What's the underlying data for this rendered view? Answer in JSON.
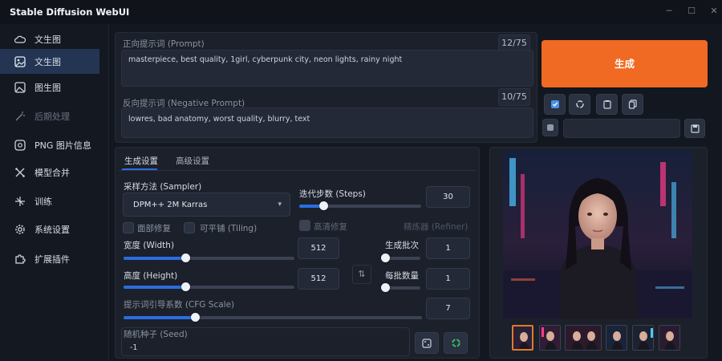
{
  "app": {
    "title": "Stable Diffusion WebUI"
  },
  "window": {
    "minimize_icon": "minimize-icon",
    "maximize_icon": "maximize-icon",
    "close_icon": "close-icon"
  },
  "sidebar": {
    "items": [
      {
        "label": "文生图",
        "icon": "cloud-icon",
        "active": false
      },
      {
        "label": "文生图",
        "icon": "image-icon",
        "active": true
      },
      {
        "label": "图生图",
        "icon": "picture-icon",
        "active": false
      },
      {
        "label": "后期处理",
        "icon": "wand-icon",
        "active": false,
        "dim": true
      },
      {
        "label": "PNG 图片信息",
        "icon": "info-icon",
        "active": false
      },
      {
        "label": "模型合并",
        "icon": "merge-icon",
        "active": false
      },
      {
        "label": "训练",
        "icon": "train-icon",
        "active": false
      },
      {
        "label": "系统设置",
        "icon": "gear-icon",
        "active": false
      },
      {
        "label": "扩展插件",
        "icon": "puzzle-icon",
        "active": false
      }
    ]
  },
  "prompt": {
    "label": "正向提示词 (Prompt)",
    "counter": "12/75",
    "value": "masterpiece, best quality, 1girl, cyberpunk city, neon lights, rainy night"
  },
  "negative_prompt": {
    "label": "反向提示词 (Negative Prompt)",
    "counter": "10/75",
    "value": "lowres, bad anatomy, worst quality, blurry, text"
  },
  "actions": {
    "generate_label": "生成",
    "tool_icons": [
      "check-icon",
      "recycle-icon",
      "clipboard-icon",
      "copy-icon"
    ],
    "style_icon": "style-icon",
    "save_icon": "save-icon"
  },
  "tabs": {
    "active": "生成设置",
    "other": "高级设置"
  },
  "settings": {
    "sampler": {
      "label": "采样方法 (Sampler)",
      "value": "DPM++ 2M Karras"
    },
    "steps": {
      "label": "迭代步数 (Steps)",
      "value": "30",
      "fraction": 0.2
    },
    "restore_faces": {
      "label": "面部修复",
      "checked": false
    },
    "tiling": {
      "label": "可平铺 (Tiling)",
      "checked": false
    },
    "hires_fix": {
      "label": "高清修复",
      "checked": false
    },
    "refiner": {
      "label": "精炼器 (Refiner)"
    },
    "width": {
      "label": "宽度 (Width)",
      "value": "512",
      "fraction": 0.36
    },
    "height": {
      "label": "高度 (Height)",
      "value": "512",
      "fraction": 0.36
    },
    "batch_count": {
      "label": "生成批次",
      "value": "1",
      "fraction": 0.0
    },
    "batch_size": {
      "label": "每批数量",
      "value": "1",
      "fraction": 0.0
    },
    "cfg": {
      "label": "提示词引导系数 (CFG Scale)",
      "value": "7",
      "fraction": 0.24
    },
    "seed": {
      "label": "随机种子 (Seed)",
      "value": "-1",
      "dice_icon": "dice-icon",
      "recycle_icon": "recycle-icon"
    },
    "swap_icon": "swap-icon"
  },
  "gallery": {
    "thumbnail_count": 6,
    "selected_index": 0
  },
  "colors": {
    "accent": "#2b6de0",
    "generate": "#f06a23",
    "sidebar_active": "#243554"
  }
}
